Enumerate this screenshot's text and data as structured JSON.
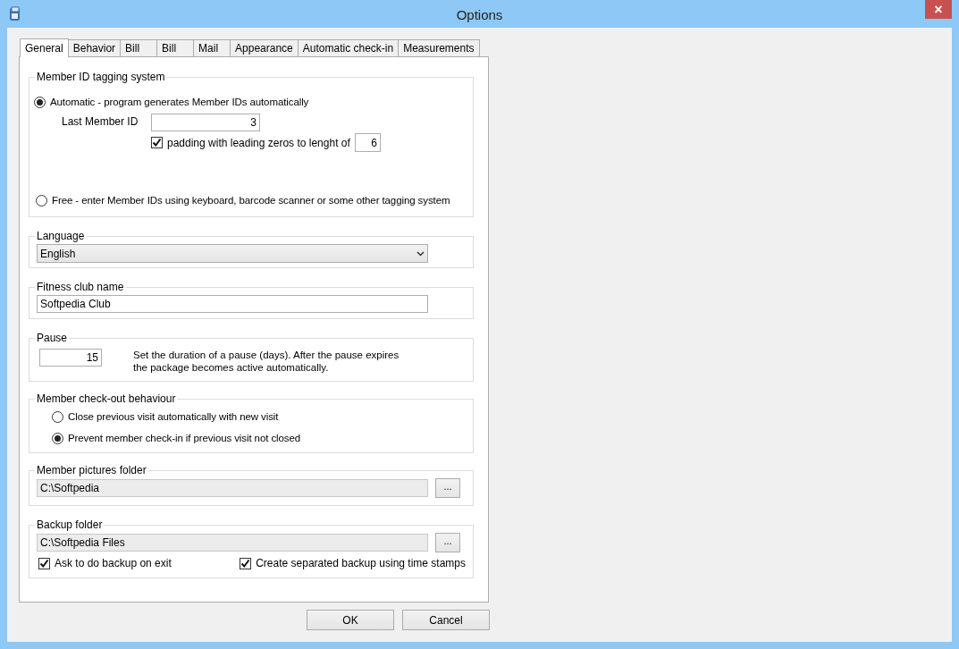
{
  "window": {
    "title": "Options",
    "close": "×"
  },
  "tabs": [
    {
      "label": "General",
      "selected": true
    },
    {
      "label": "Behavior",
      "selected": false
    },
    {
      "label": "Bill",
      "selected": false
    },
    {
      "label": "Bill",
      "selected": false
    },
    {
      "label": "Mail",
      "selected": false
    },
    {
      "label": "Appearance",
      "selected": false
    },
    {
      "label": "Automatic check-in",
      "selected": false
    },
    {
      "label": "Measurements",
      "selected": false
    }
  ],
  "member_id": {
    "title": "Member ID tagging system",
    "automatic": {
      "label": "Automatic - program generates Member IDs automatically",
      "selected": true
    },
    "last_member_id": {
      "label": "Last Member ID",
      "value": "3"
    },
    "padding": {
      "label": "padding with leading zeros to lenght of",
      "checked": true,
      "value": "6"
    },
    "free": {
      "label": "Free - enter Member IDs using keyboard, barcode scanner or some other tagging system",
      "selected": false
    }
  },
  "language": {
    "title": "Language",
    "value": "English"
  },
  "club_name": {
    "title": "Fitness club name",
    "value": "Softpedia Club"
  },
  "pause": {
    "title": "Pause",
    "value": "15",
    "description": "Set the duration of a pause (days). After the pause expires the package becomes active automatically."
  },
  "checkout": {
    "title": "Member check-out behaviour",
    "options": [
      {
        "label": "Close previous visit automatically with new visit",
        "selected": false
      },
      {
        "label": "Prevent member check-in if previous visit not closed",
        "selected": true
      }
    ]
  },
  "pictures_folder": {
    "title": "Member pictures folder",
    "value": "C:\\Softpedia",
    "browse": "..."
  },
  "backup_folder": {
    "title": "Backup folder",
    "value": "C:\\Softpedia Files",
    "browse": "...",
    "options": [
      {
        "label": "Ask to do backup on exit",
        "checked": true
      },
      {
        "label": "Create separated backup using time stamps",
        "checked": true
      }
    ]
  },
  "buttons": [
    "OK",
    "Cancel"
  ]
}
